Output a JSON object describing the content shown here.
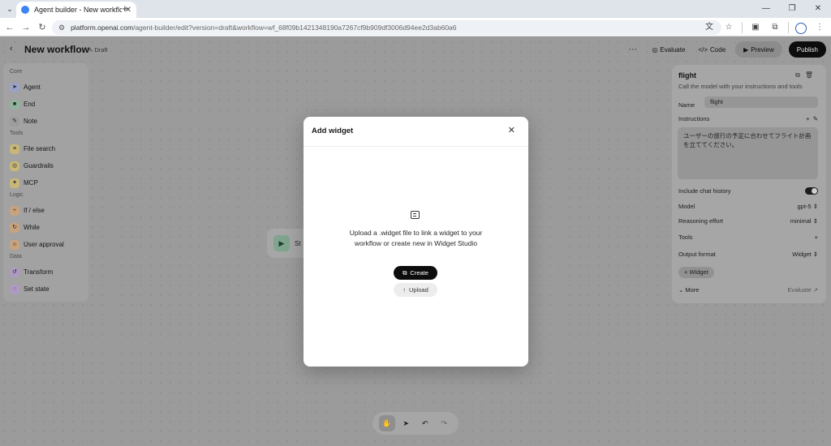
{
  "browser": {
    "tab_title": "Agent builder - New workflow",
    "url_host": "platform.openai.com",
    "url_path": "/agent-builder/edit?version=draft&workflow=wf_68f09b1421348190a7267cf9b909df3006d94ee2d3ab60a6"
  },
  "header": {
    "title": "New workflow",
    "status": "Draft",
    "evaluate": "Evaluate",
    "code": "Code",
    "preview": "Preview",
    "publish": "Publish"
  },
  "sidebar": {
    "sections": [
      {
        "label": "Core",
        "items": [
          {
            "label": "Agent",
            "icon": "agent-icon",
            "color": "#9aa2c6"
          },
          {
            "label": "End",
            "icon": "end-icon",
            "color": "#8fb39d"
          },
          {
            "label": "Note",
            "icon": "note-icon",
            "color": "#9c9c9c"
          }
        ]
      },
      {
        "label": "Tools",
        "items": [
          {
            "label": "File search",
            "icon": "file-search-icon",
            "color": "#c8b776"
          },
          {
            "label": "Guardrails",
            "icon": "guardrails-icon",
            "color": "#c8b776"
          },
          {
            "label": "MCP",
            "icon": "mcp-icon",
            "color": "#c8b776"
          }
        ]
      },
      {
        "label": "Logic",
        "items": [
          {
            "label": "If / else",
            "icon": "if-else-icon",
            "color": "#c9a27e"
          },
          {
            "label": "While",
            "icon": "while-icon",
            "color": "#c9a27e"
          },
          {
            "label": "User approval",
            "icon": "user-approval-icon",
            "color": "#c9a27e"
          }
        ]
      },
      {
        "label": "Data",
        "items": [
          {
            "label": "Transform",
            "icon": "transform-icon",
            "color": "#ad9bc2"
          },
          {
            "label": "Set state",
            "icon": "set-state-icon",
            "color": "#ad9bc2"
          }
        ]
      }
    ]
  },
  "canvas": {
    "start_node_label": "St"
  },
  "panel": {
    "title": "flight",
    "subtitle": "Call the model with your instructions and tools",
    "name_label": "Name",
    "name_value": "flight",
    "instructions_label": "Instructions",
    "instructions_value": "ユーザーの旅行の予定に合わせてフライト計画を立ててください。",
    "chat_history_label": "Include chat history",
    "model_label": "Model",
    "model_value": "gpt-5",
    "reasoning_label": "Reasoning effort",
    "reasoning_value": "minimal",
    "tools_label": "Tools",
    "output_label": "Output format",
    "output_value": "Widget",
    "widget_chip": "Widget",
    "more": "More",
    "evaluate": "Evaluate"
  },
  "modal": {
    "title": "Add widget",
    "description": "Upload a .widget file to link a widget to your workflow or create new in Widget Studio",
    "create": "Create",
    "upload": "Upload"
  }
}
